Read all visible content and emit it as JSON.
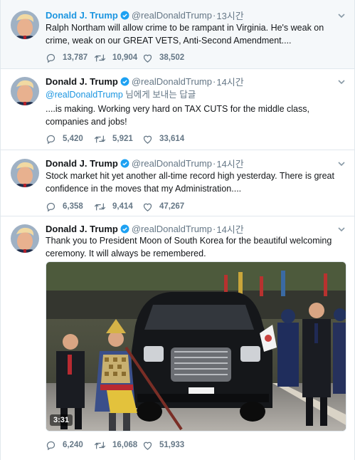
{
  "colors": {
    "link": "#1b95e0",
    "muted": "#657786",
    "text": "#14171a",
    "verified": "#1da1f2"
  },
  "tweets": [
    {
      "name": "Donald J. Trump",
      "handle": "@realDonaldTrump",
      "separator": "·",
      "time": "13시간",
      "text": "Ralph Northam will allow crime to be rampant in Virginia. He's weak on crime, weak on our GREAT VETS, Anti-Second Amendment....",
      "replies": "13,787",
      "retweets": "10,904",
      "likes": "38,502"
    },
    {
      "name": "Donald J. Trump",
      "handle": "@realDonaldTrump",
      "separator": "·",
      "time": "14시간",
      "reply_to_handle": "@realDonaldTrump",
      "reply_to_suffix": " 님에게 보내는 답글",
      "text": "....is making. Working very hard on TAX CUTS for the middle class, companies and jobs!",
      "replies": "5,420",
      "retweets": "5,921",
      "likes": "33,614"
    },
    {
      "name": "Donald J. Trump",
      "handle": "@realDonaldTrump",
      "separator": "·",
      "time": "14시간",
      "text": "Stock market hit yet another all-time record high yesterday. There is great confidence in the moves that my Administration....",
      "replies": "6,358",
      "retweets": "9,414",
      "likes": "47,267"
    },
    {
      "name": "Donald J. Trump",
      "handle": "@realDonaldTrump",
      "separator": "·",
      "time": "14시간",
      "text": "Thank you to President Moon of South Korea for the beautiful welcoming ceremony. It will always be remembered.",
      "video_duration": "3:31",
      "replies": "6,240",
      "retweets": "16,068",
      "likes": "51,933"
    }
  ],
  "icons": {
    "avatar": "avatar-photo",
    "verified": "verified-badge-icon",
    "caret": "chevron-down-icon",
    "reply": "reply-icon",
    "retweet": "retweet-icon",
    "like": "heart-icon"
  }
}
